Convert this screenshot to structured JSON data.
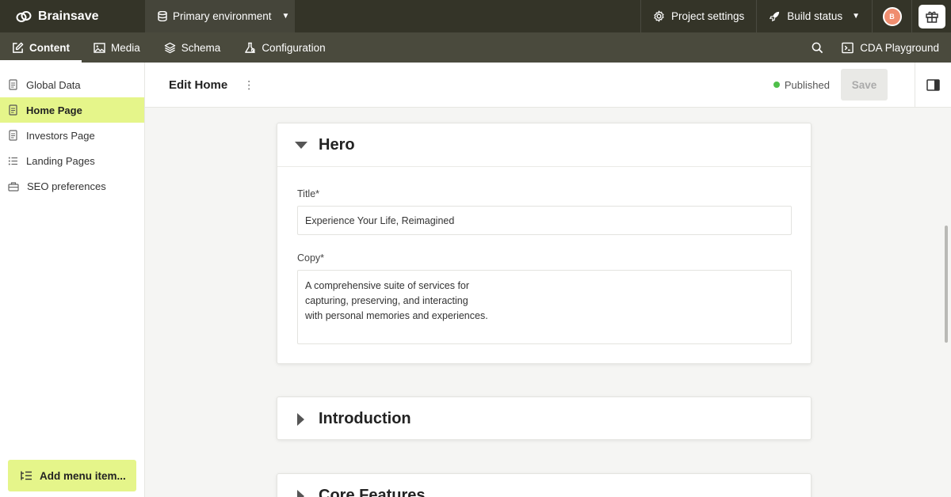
{
  "app": {
    "brand": "Brainsave",
    "environment": "Primary environment",
    "project_settings": "Project settings",
    "build_status": "Build status",
    "avatar_initial": "B"
  },
  "nav": {
    "tabs": [
      {
        "label": "Content",
        "icon": "edit-icon"
      },
      {
        "label": "Media",
        "icon": "image-icon"
      },
      {
        "label": "Schema",
        "icon": "layers-icon"
      },
      {
        "label": "Configuration",
        "icon": "flask-icon"
      }
    ],
    "cda_playground": "CDA Playground"
  },
  "sidebar": {
    "items": [
      {
        "label": "Global Data",
        "icon": "document-icon"
      },
      {
        "label": "Home Page",
        "icon": "document-icon"
      },
      {
        "label": "Investors Page",
        "icon": "document-icon"
      },
      {
        "label": "Landing Pages",
        "icon": "list-icon"
      },
      {
        "label": "SEO preferences",
        "icon": "toolbox-icon"
      }
    ],
    "add_menu_item": "Add menu item..."
  },
  "header": {
    "title": "Edit Home",
    "status": "Published",
    "save": "Save"
  },
  "hero": {
    "heading": "Hero",
    "title_label": "Title*",
    "title_value": "Experience Your Life, Reimagined",
    "copy_label": "Copy*",
    "copy_value": "A comprehensive suite of services for\ncapturing, preserving, and interacting\nwith personal memories and experiences."
  },
  "sections": {
    "introduction": "Introduction",
    "core_features": "Core Features"
  },
  "colors": {
    "topbar": "#343428",
    "navbar": "#4a4a3d",
    "accent": "#e5f58a",
    "published": "#4fbf4a"
  }
}
